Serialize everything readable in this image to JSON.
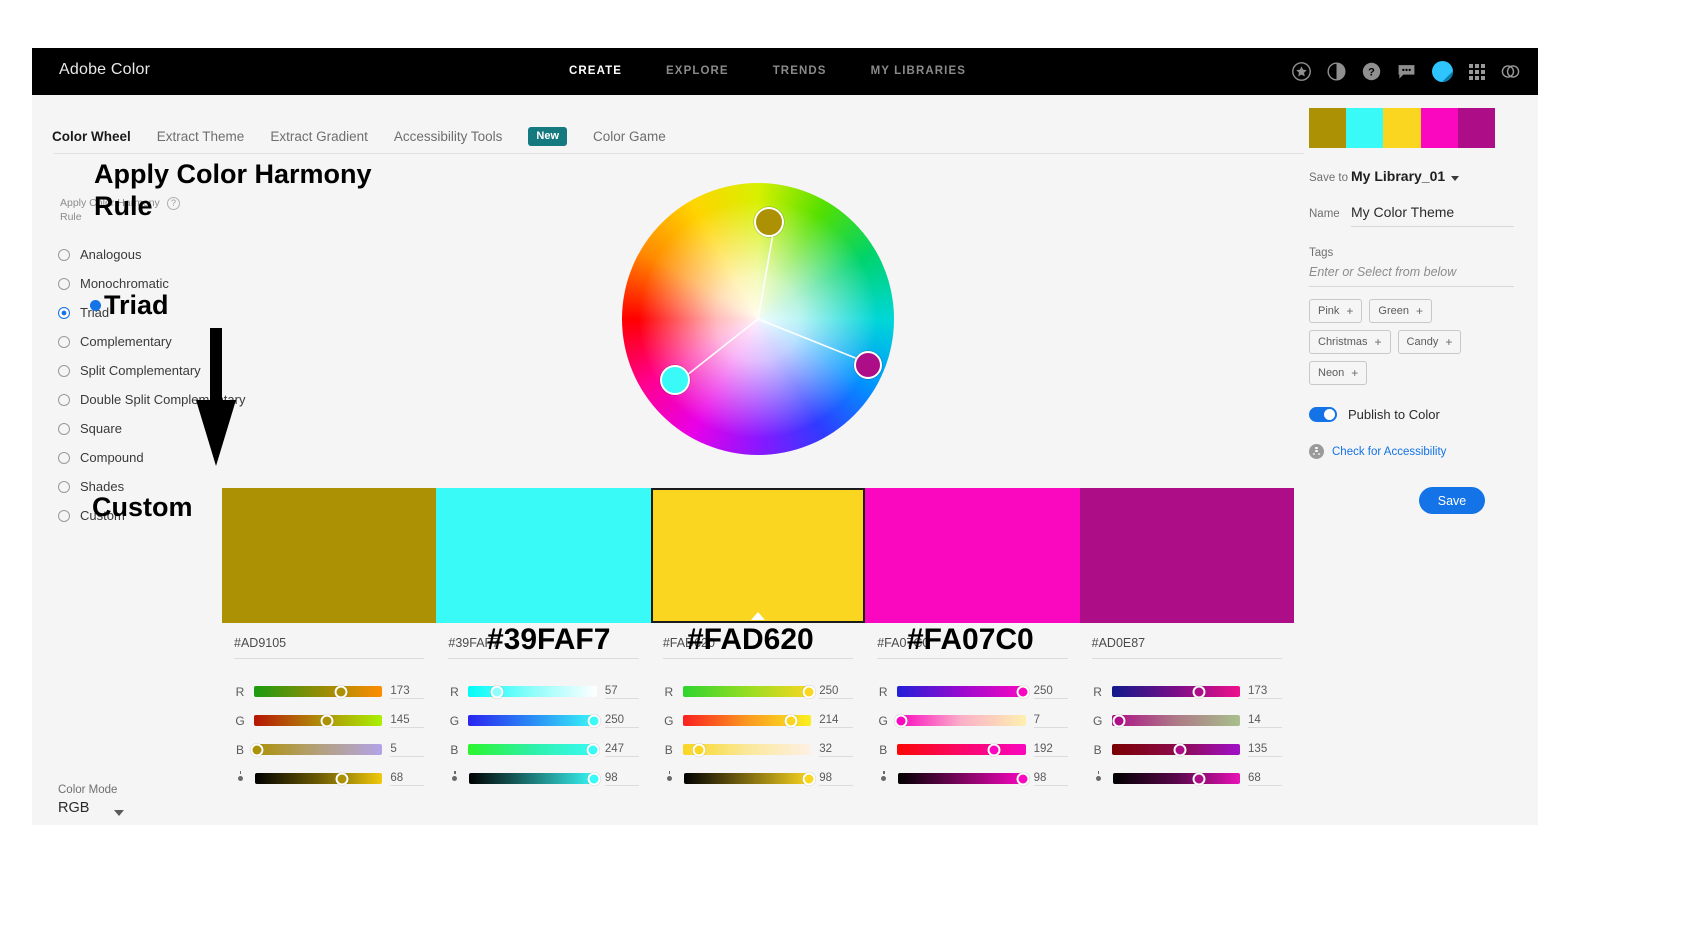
{
  "header": {
    "brand": "Adobe Color",
    "nav": [
      {
        "label": "CREATE",
        "active": true
      },
      {
        "label": "EXPLORE",
        "active": false
      },
      {
        "label": "TRENDS",
        "active": false
      },
      {
        "label": "MY LIBRARIES",
        "active": false
      }
    ],
    "icons": [
      "star-icon",
      "theme-contrast-icon",
      "help-icon",
      "feedback-icon",
      "user-avatar",
      "app-grid-icon",
      "creative-cloud-icon"
    ]
  },
  "subnav": {
    "items": [
      {
        "label": "Color Wheel",
        "active": true,
        "badge": null
      },
      {
        "label": "Extract Theme",
        "active": false,
        "badge": null
      },
      {
        "label": "Extract Gradient",
        "active": false,
        "badge": null
      },
      {
        "label": "Accessibility Tools",
        "active": false,
        "badge": "New"
      },
      {
        "label": "Color Game",
        "active": false,
        "badge": null
      }
    ]
  },
  "harmony": {
    "label": "Apply Color Harmony Rule",
    "help_icon": "question-mark-icon",
    "rules": [
      {
        "label": "Analogous",
        "selected": false
      },
      {
        "label": "Monochromatic",
        "selected": false
      },
      {
        "label": "Triad",
        "selected": true
      },
      {
        "label": "Complementary",
        "selected": false
      },
      {
        "label": "Split Complementary",
        "selected": false
      },
      {
        "label": "Double Split Complementary",
        "selected": false
      },
      {
        "label": "Square",
        "selected": false
      },
      {
        "label": "Compound",
        "selected": false
      },
      {
        "label": "Shades",
        "selected": false
      },
      {
        "label": "Custom",
        "selected": false
      }
    ]
  },
  "color_mode": {
    "label": "Color Mode",
    "value": "RGB"
  },
  "swatches": [
    {
      "hex": "#AD9105",
      "active": false,
      "sliders": [
        {
          "channel": "R",
          "value": "173",
          "pos": 67.8,
          "from": "#1a9c10",
          "mid": "#8f8c05",
          "to": "#ff8c00"
        },
        {
          "channel": "G",
          "value": "145",
          "pos": 56.9,
          "from": "#b61505",
          "mid": "#b08a0a",
          "to": "#aaf000"
        },
        {
          "channel": "B",
          "value": "5",
          "pos": 2.0,
          "from": "#ad9105",
          "mid": "#b3a07a",
          "to": "#b3a3e8"
        },
        {
          "channel": "brightness",
          "value": "68",
          "pos": 68.0,
          "from": "#000000",
          "mid": "#6b5a03",
          "to": "#f0c90a"
        }
      ]
    },
    {
      "hex": "#39FAF7",
      "active": false,
      "sliders": [
        {
          "channel": "R",
          "value": "57",
          "pos": 22.3,
          "from": "#00fcf8",
          "mid": "#8efdfb",
          "to": "#ffffff"
        },
        {
          "channel": "G",
          "value": "250",
          "pos": 98.0,
          "from": "#2a23f0",
          "mid": "#2a8cf5",
          "to": "#39faf7"
        },
        {
          "channel": "B",
          "value": "247",
          "pos": 96.9,
          "from": "#2cf52c",
          "mid": "#2ef0a8",
          "to": "#39faf7"
        },
        {
          "channel": "brightness",
          "value": "98",
          "pos": 98.0,
          "from": "#000000",
          "mid": "#1c7c7a",
          "to": "#39faf7"
        }
      ]
    },
    {
      "hex": "#FAD620",
      "active": true,
      "sliders": [
        {
          "channel": "R",
          "value": "250",
          "pos": 98.0,
          "from": "#2fd42f",
          "mid": "#95dd22",
          "to": "#fad620"
        },
        {
          "channel": "G",
          "value": "214",
          "pos": 84.0,
          "from": "#fa2020",
          "mid": "#fa9820",
          "to": "#faf020"
        },
        {
          "channel": "B",
          "value": "32",
          "pos": 12.5,
          "from": "#fad620",
          "mid": "#fae89a",
          "to": "#fdf0e4"
        },
        {
          "channel": "brightness",
          "value": "98",
          "pos": 98.0,
          "from": "#000000",
          "mid": "#7d6a10",
          "to": "#fad620"
        }
      ]
    },
    {
      "hex": "#FA07C0",
      "active": false,
      "sliders": [
        {
          "channel": "R",
          "value": "250",
          "pos": 98.0,
          "from": "#2020d8",
          "mid": "#9a09cf",
          "to": "#fa07c0"
        },
        {
          "channel": "G",
          "value": "7",
          "pos": 2.7,
          "from": "#fa07c0",
          "mid": "#fbb0c8",
          "to": "#fdf0b0"
        },
        {
          "channel": "B",
          "value": "192",
          "pos": 75.3,
          "from": "#fa0707",
          "mid": "#fa0768",
          "to": "#fa07c0"
        },
        {
          "channel": "brightness",
          "value": "98",
          "pos": 98.0,
          "from": "#000000",
          "mid": "#7d0360",
          "to": "#fa07c0"
        }
      ]
    },
    {
      "hex": "#AD0E87",
      "active": false,
      "sliders": [
        {
          "channel": "R",
          "value": "173",
          "pos": 67.8,
          "from": "#101a8c",
          "mid": "#7a0e87",
          "to": "#f0108c"
        },
        {
          "channel": "G",
          "value": "14",
          "pos": 5.5,
          "from": "#ad0e87",
          "mid": "#ad7a87",
          "to": "#a8c08c"
        },
        {
          "channel": "B",
          "value": "135",
          "pos": 52.9,
          "from": "#7a0000",
          "mid": "#8c0a4a",
          "to": "#a010c8"
        },
        {
          "channel": "brightness",
          "value": "68",
          "pos": 68.0,
          "from": "#000000",
          "mid": "#58064a",
          "to": "#e812b6"
        }
      ]
    }
  ],
  "right_panel": {
    "save_to_label": "Save to",
    "library": "My Library_01",
    "name_label": "Name",
    "name_value": "My Color Theme",
    "tags_label": "Tags",
    "tags_placeholder": "Enter or Select from below",
    "tag_chips": [
      "Pink",
      "Green",
      "Christmas",
      "Candy",
      "Neon"
    ],
    "publish_label": "Publish to Color",
    "publish_on": true,
    "accessibility_link": "Check for Accessibility",
    "save_button": "Save"
  },
  "wheel": {
    "markers": [
      {
        "x": 56,
        "y": 12,
        "size": 26,
        "color": "#AD9105"
      },
      {
        "x": 18,
        "y": 70,
        "size": 26,
        "color": "#39FAF7"
      },
      {
        "x": 91,
        "y": 64,
        "size": 24,
        "color": "#AD0E87"
      }
    ]
  },
  "annotations": {
    "title": "Apply Color Harmony\nRule",
    "triad": "Triad",
    "custom": "Custom",
    "hex2": "#39FAF7",
    "hex3": "#FAD620",
    "hex4": "#FA07C0",
    "arrow": "down-arrow"
  }
}
